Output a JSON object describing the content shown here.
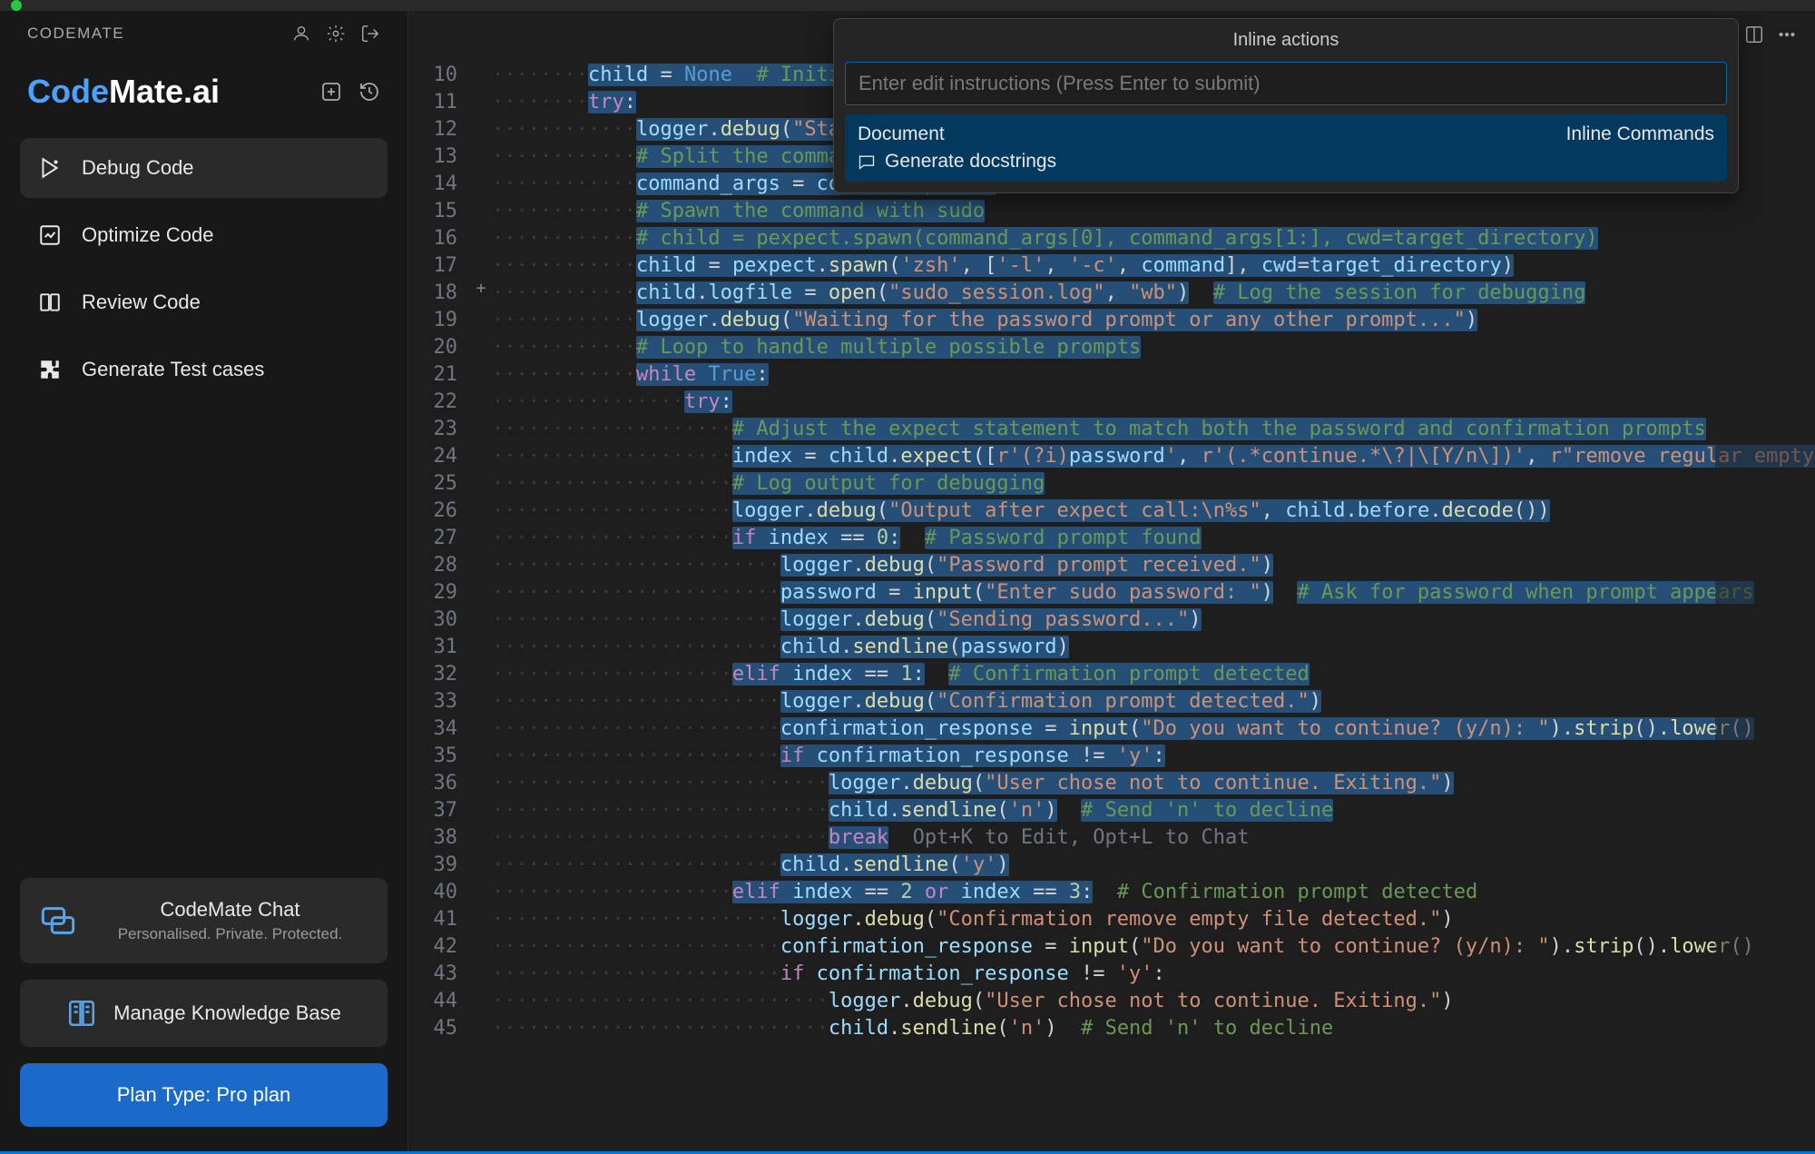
{
  "app_title": "CODEMATE",
  "logo": {
    "part1": "Code",
    "part2": "Mate",
    "part3": ".ai"
  },
  "nav": [
    {
      "label": "Debug Code",
      "icon": "debug-icon",
      "active": true
    },
    {
      "label": "Optimize Code",
      "icon": "optimize-icon",
      "active": false
    },
    {
      "label": "Review Code",
      "icon": "review-icon",
      "active": false
    },
    {
      "label": "Generate Test cases",
      "icon": "puzzle-icon",
      "active": false
    }
  ],
  "chat_card": {
    "title": "CodeMate Chat",
    "subtitle": "Personalised. Private. Protected."
  },
  "kb_card": {
    "label": "Manage Knowledge Base"
  },
  "plan_button": "Plan Type: Pro plan",
  "inline_popup": {
    "title": "Inline actions",
    "placeholder": "Enter edit instructions (Press Enter to submit)",
    "suggestion_header_left": "Document",
    "suggestion_header_right": "Inline Commands",
    "suggestion_item": "Generate docstrings"
  },
  "ghost_hint": "Opt+K to Edit, Opt+L to Chat",
  "line_numbers_start": 10,
  "line_numbers_end": 45,
  "code_lines": [
    {
      "n": 10,
      "html": "<span class='ws'>········</span><span class='sel'><span class='id'>child</span> <span class='op'>=</span> <span class='bool'>None</span>  <span class='cmt'># Initialize child to None to avoid UnboundLocalError</span></span>"
    },
    {
      "n": 11,
      "html": "<span class='ws'>········</span><span class='sel'><span class='kw'>try</span><span class='op'>:</span></span>"
    },
    {
      "n": 12,
      "html": "<span class='ws'>············</span><span class='sel'><span class='id'>logger</span><span class='op'>.</span><span class='fn'>debug</span><span class='op'>(</span><span class='str'>\"Starting subprocess for command: %s\"</span><span class='op'>,</span> <span class='id'>command</span><span class='op'>)</span></span>"
    },
    {
      "n": 13,
      "html": "<span class='ws'>············</span><span class='sel'><span class='cmt'># Split the command into a list of arguments</span></span>"
    },
    {
      "n": 14,
      "html": "<span class='ws'>············</span><span class='sel'><span class='id'>command_args</span> <span class='op'>=</span> <span class='id'>command</span><span class='op'>.</span><span class='fn'>split</span><span class='op'>()</span></span>"
    },
    {
      "n": 15,
      "html": "<span class='ws'>············</span><span class='sel'><span class='cmt'># Spawn the command with sudo</span></span>"
    },
    {
      "n": 16,
      "html": "<span class='ws'>············</span><span class='sel'><span class='cmt'># child = pexpect.spawn(command_args[0], command_args[1:], cwd=target_directory)</span></span>"
    },
    {
      "n": 17,
      "html": "<span class='ws'>············</span><span class='sel'><span class='id'>child</span> <span class='op'>=</span> <span class='id'>pexpect</span><span class='op'>.</span><span class='fn'>spawn</span><span class='op'>(</span><span class='str'>'zsh'</span><span class='op'>,</span> <span class='op'>[</span><span class='str'>'-l'</span><span class='op'>,</span> <span class='str'>'-c'</span><span class='op'>,</span> <span class='id'>command</span><span class='op'>],</span> <span class='id'>cwd</span><span class='op'>=</span><span class='id'>target_directory</span><span class='op'>)</span></span>"
    },
    {
      "n": 18,
      "html": "<span class='ws'>············</span><span class='sel'><span class='id'>child</span><span class='op'>.</span><span class='id'>logfile</span> <span class='op'>=</span> <span class='fn'>open</span><span class='op'>(</span><span class='str'>\"sudo_session.log\"</span><span class='op'>,</span> <span class='str'>\"wb\"</span><span class='op'>)</span></span>  <span class='sel'><span class='cmt'># Log the session for debugging</span></span>"
    },
    {
      "n": 19,
      "html": "<span class='ws'>············</span><span class='sel'><span class='id'>logger</span><span class='op'>.</span><span class='fn'>debug</span><span class='op'>(</span><span class='str'>\"Waiting for the password prompt or any other prompt...\"</span><span class='op'>)</span></span>"
    },
    {
      "n": 20,
      "html": "<span class='ws'>············</span><span class='sel'><span class='cmt'># Loop to handle multiple possible prompts</span></span>"
    },
    {
      "n": 21,
      "html": "<span class='ws'>············</span><span class='sel'><span class='kw'>while</span> <span class='bool'>True</span><span class='op'>:</span></span>"
    },
    {
      "n": 22,
      "html": "<span class='ws'>················</span><span class='sel'><span class='kw'>try</span><span class='op'>:</span></span>"
    },
    {
      "n": 23,
      "html": "<span class='ws'>····················</span><span class='sel'><span class='cmt'># Adjust the expect statement to match both the password and confirmation prompts</span></span>"
    },
    {
      "n": 24,
      "html": "<span class='ws'>····················</span><span class='sel'><span class='id'>index</span> <span class='op'>=</span> <span class='id'>child</span><span class='op'>.</span><span class='fn'>expect</span><span class='op'>([</span><span class='str'>r'(?i)</span><span class='id'>password</span><span class='str'>'</span><span class='op'>,</span> <span class='str'>r'(.*continue.*\\?|\\[Y/n\\])'</span><span class='op'>,</span> <span class='str'>r\"remove regular empty file '.*'\\?</span></span>"
    },
    {
      "n": 25,
      "html": "<span class='ws'>····················</span><span class='sel'><span class='cmt'># Log output for debugging</span></span>"
    },
    {
      "n": 26,
      "html": "<span class='ws'>····················</span><span class='sel'><span class='id'>logger</span><span class='op'>.</span><span class='fn'>debug</span><span class='op'>(</span><span class='str'>\"Output after expect call:\\n%s\"</span><span class='op'>,</span> <span class='id'>child</span><span class='op'>.</span><span class='id'>before</span><span class='op'>.</span><span class='fn'>decode</span><span class='op'>())</span></span>"
    },
    {
      "n": 27,
      "html": "<span class='ws'>····················</span><span class='sel'><span class='kw'>if</span> <span class='id'>index</span> <span class='op'>==</span> <span class='num'>0</span><span class='op'>:</span></span>  <span class='sel'><span class='cmt'># Password prompt found</span></span>"
    },
    {
      "n": 28,
      "html": "<span class='ws'>························</span><span class='sel'><span class='id'>logger</span><span class='op'>.</span><span class='fn'>debug</span><span class='op'>(</span><span class='str'>\"Password prompt received.\"</span><span class='op'>)</span></span>"
    },
    {
      "n": 29,
      "html": "<span class='ws'>························</span><span class='sel'><span class='id'>password</span> <span class='op'>=</span> <span class='fn'>input</span><span class='op'>(</span><span class='str'>\"Enter sudo password: \"</span><span class='op'>)</span></span>  <span class='sel'><span class='cmt'># Ask for password when prompt appears</span></span>"
    },
    {
      "n": 30,
      "html": "<span class='ws'>························</span><span class='sel'><span class='id'>logger</span><span class='op'>.</span><span class='fn'>debug</span><span class='op'>(</span><span class='str'>\"Sending password...\"</span><span class='op'>)</span></span>"
    },
    {
      "n": 31,
      "html": "<span class='ws'>························</span><span class='sel'><span class='id'>child</span><span class='op'>.</span><span class='fn'>sendline</span><span class='op'>(</span><span class='id'>password</span><span class='op'>)</span></span>"
    },
    {
      "n": 32,
      "html": "<span class='ws'>····················</span><span class='sel'><span class='kw'>elif</span> <span class='id'>index</span> <span class='op'>==</span> <span class='num'>1</span><span class='op'>:</span></span>  <span class='sel'><span class='cmt'># Confirmation prompt detected</span></span>"
    },
    {
      "n": 33,
      "html": "<span class='ws'>························</span><span class='sel'><span class='id'>logger</span><span class='op'>.</span><span class='fn'>debug</span><span class='op'>(</span><span class='str'>\"Confirmation prompt detected.\"</span><span class='op'>)</span></span>"
    },
    {
      "n": 34,
      "html": "<span class='ws'>························</span><span class='sel'><span class='id'>confirmation_response</span> <span class='op'>=</span> <span class='fn'>input</span><span class='op'>(</span><span class='str'>\"Do you want to continue? (y/n): \"</span><span class='op'>).</span><span class='fn'>strip</span><span class='op'>().</span><span class='fn'>lower</span><span class='op'>()</span></span>"
    },
    {
      "n": 35,
      "html": "<span class='ws'>························</span><span class='sel'><span class='kw'>if</span> <span class='id'>confirmation_response</span> <span class='op'>!=</span> <span class='str'>'y'</span><span class='op'>:</span></span>"
    },
    {
      "n": 36,
      "html": "<span class='ws'>····························</span><span class='sel'><span class='id'>logger</span><span class='op'>.</span><span class='fn'>debug</span><span class='op'>(</span><span class='str'>\"User chose not to continue. Exiting.\"</span><span class='op'>)</span></span>"
    },
    {
      "n": 37,
      "html": "<span class='ws'>····························</span><span class='sel'><span class='id'>child</span><span class='op'>.</span><span class='fn'>sendline</span><span class='op'>(</span><span class='str'>'n'</span><span class='op'>)</span></span>  <span class='sel'><span class='cmt'># Send 'n' to decline</span></span>"
    },
    {
      "n": 38,
      "html": "<span class='ws'>····························</span><span class='sel'><span class='kw'>break</span></span>  <span class='ghost' data-bind='ghost_hint'></span>"
    },
    {
      "n": 39,
      "html": "<span class='ws'>························</span><span class='sel'><span class='id'>child</span><span class='op'>.</span><span class='fn'>sendline</span><span class='op'>(</span><span class='str'>'y'</span><span class='op'>)</span></span>"
    },
    {
      "n": 40,
      "html": "<span class='ws'>····················</span><span class='sel'><span class='kw'>elif</span> <span class='id'>index</span> <span class='op'>==</span> <span class='num'>2</span> <span class='kw'>or</span> <span class='id'>index</span> <span class='op'>==</span> <span class='num'>3</span><span class='op'>:</span></span>  <span class='cmt'># Confirmation prompt detected</span>"
    },
    {
      "n": 41,
      "html": "<span class='ws'>························</span><span class='id'>logger</span><span class='op'>.</span><span class='fn'>debug</span><span class='op'>(</span><span class='str'>\"Confirmation remove empty file detected.\"</span><span class='op'>)</span>"
    },
    {
      "n": 42,
      "html": "<span class='ws'>························</span><span class='id'>confirmation_response</span> <span class='op'>=</span> <span class='fn'>input</span><span class='op'>(</span><span class='str'>\"Do you want to continue? (y/n): \"</span><span class='op'>).</span><span class='fn'>strip</span><span class='op'>().</span><span class='fn'>lower</span><span class='op'>()</span>"
    },
    {
      "n": 43,
      "html": "<span class='ws'>························</span><span class='kw'>if</span> <span class='id'>confirmation_response</span> <span class='op'>!=</span> <span class='str'>'y'</span><span class='op'>:</span>"
    },
    {
      "n": 44,
      "html": "<span class='ws'>····························</span><span class='id'>logger</span><span class='op'>.</span><span class='fn'>debug</span><span class='op'>(</span><span class='str'>\"User chose not to continue. Exiting.\"</span><span class='op'>)</span>"
    },
    {
      "n": 45,
      "html": "<span class='ws'>····························</span><span class='id'>child</span><span class='op'>.</span><span class='fn'>sendline</span><span class='op'>(</span><span class='str'>'n'</span><span class='op'>)</span>  <span class='cmt'># Send 'n' to decline</span>"
    }
  ]
}
